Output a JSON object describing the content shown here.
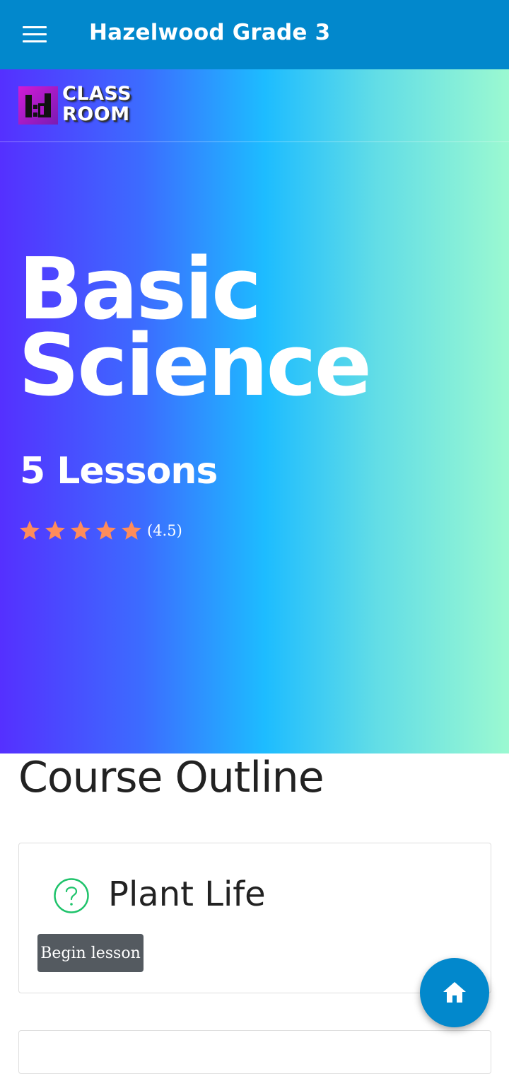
{
  "appbar": {
    "title": "Hazelwood Grade 3",
    "menu_icon": "menu-icon"
  },
  "logo": {
    "line1": "CLASS",
    "line2": "ROOM",
    "mark_text": ":d"
  },
  "hero": {
    "title_line1": "Basic",
    "title_line2": "Science",
    "lessons": "5 Lessons",
    "rating_stars": 5,
    "rating_text": "(4.5)",
    "star_color": "#ff8c5a",
    "gradient": [
      "#5530ff",
      "#1dbcff",
      "#9bf9d1"
    ]
  },
  "outline": {
    "heading": "Course Outline",
    "lessons": [
      {
        "title": "Plant Life",
        "icon": "question-circle-icon",
        "icon_color": "#1fc36b",
        "button_label": "Begin lesson"
      }
    ]
  },
  "fab": {
    "icon": "home-icon",
    "color": "#0288cc"
  }
}
